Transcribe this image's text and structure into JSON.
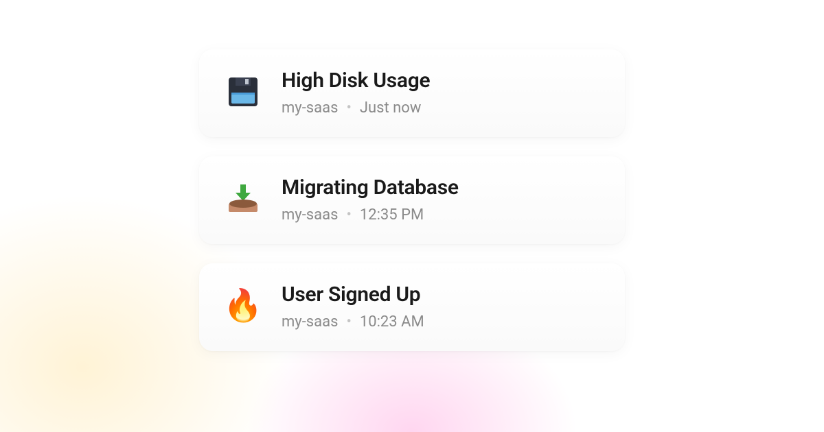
{
  "cards": [
    {
      "icon": "floppy-disk-icon",
      "title": "High Disk Usage",
      "project": "my-saas",
      "time": "Just now"
    },
    {
      "icon": "download-tray-icon",
      "title": "Migrating Database",
      "project": "my-saas",
      "time": "12:35 PM"
    },
    {
      "icon": "fire-icon",
      "title": "User Signed Up",
      "project": "my-saas",
      "time": "10:23 AM"
    }
  ]
}
